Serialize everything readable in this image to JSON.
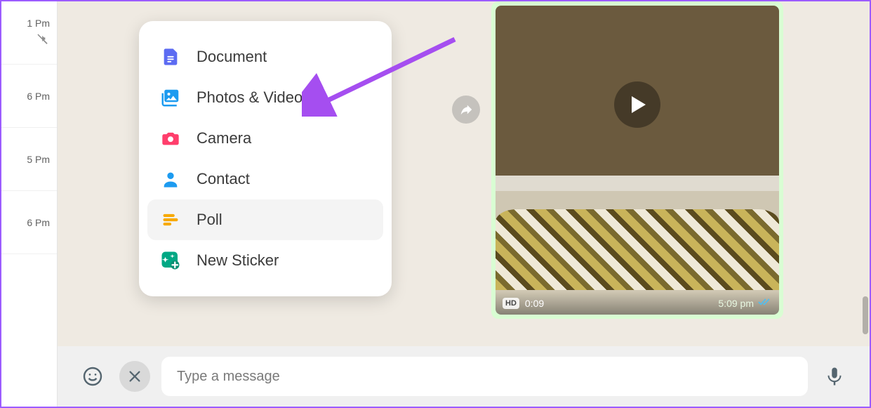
{
  "sidebar": {
    "items": [
      {
        "time": "1 Pm",
        "muted": true
      },
      {
        "time": "6 Pm",
        "muted": false
      },
      {
        "time": "5 Pm",
        "muted": false
      },
      {
        "time": "6 Pm",
        "muted": false
      }
    ]
  },
  "attach_menu": {
    "items": [
      {
        "label": "Document",
        "icon": "document-icon",
        "color": "#5c6bf2"
      },
      {
        "label": "Photos & Videos",
        "icon": "photos-videos-icon",
        "color": "#1d9bf0"
      },
      {
        "label": "Camera",
        "icon": "camera-icon",
        "color": "#ff3e6c"
      },
      {
        "label": "Contact",
        "icon": "contact-icon",
        "color": "#1d9bf0"
      },
      {
        "label": "Poll",
        "icon": "poll-icon",
        "color": "#f7a900"
      },
      {
        "label": "New Sticker",
        "icon": "new-sticker-icon",
        "color": "#00a884"
      }
    ],
    "hovered_index": 4
  },
  "video": {
    "hd": "HD",
    "duration": "0:09",
    "time": "5:09 pm",
    "status_icon": "double-check-icon"
  },
  "composer": {
    "placeholder": "Type a message"
  },
  "annotation": {
    "arrow_color": "#a54ef0"
  }
}
